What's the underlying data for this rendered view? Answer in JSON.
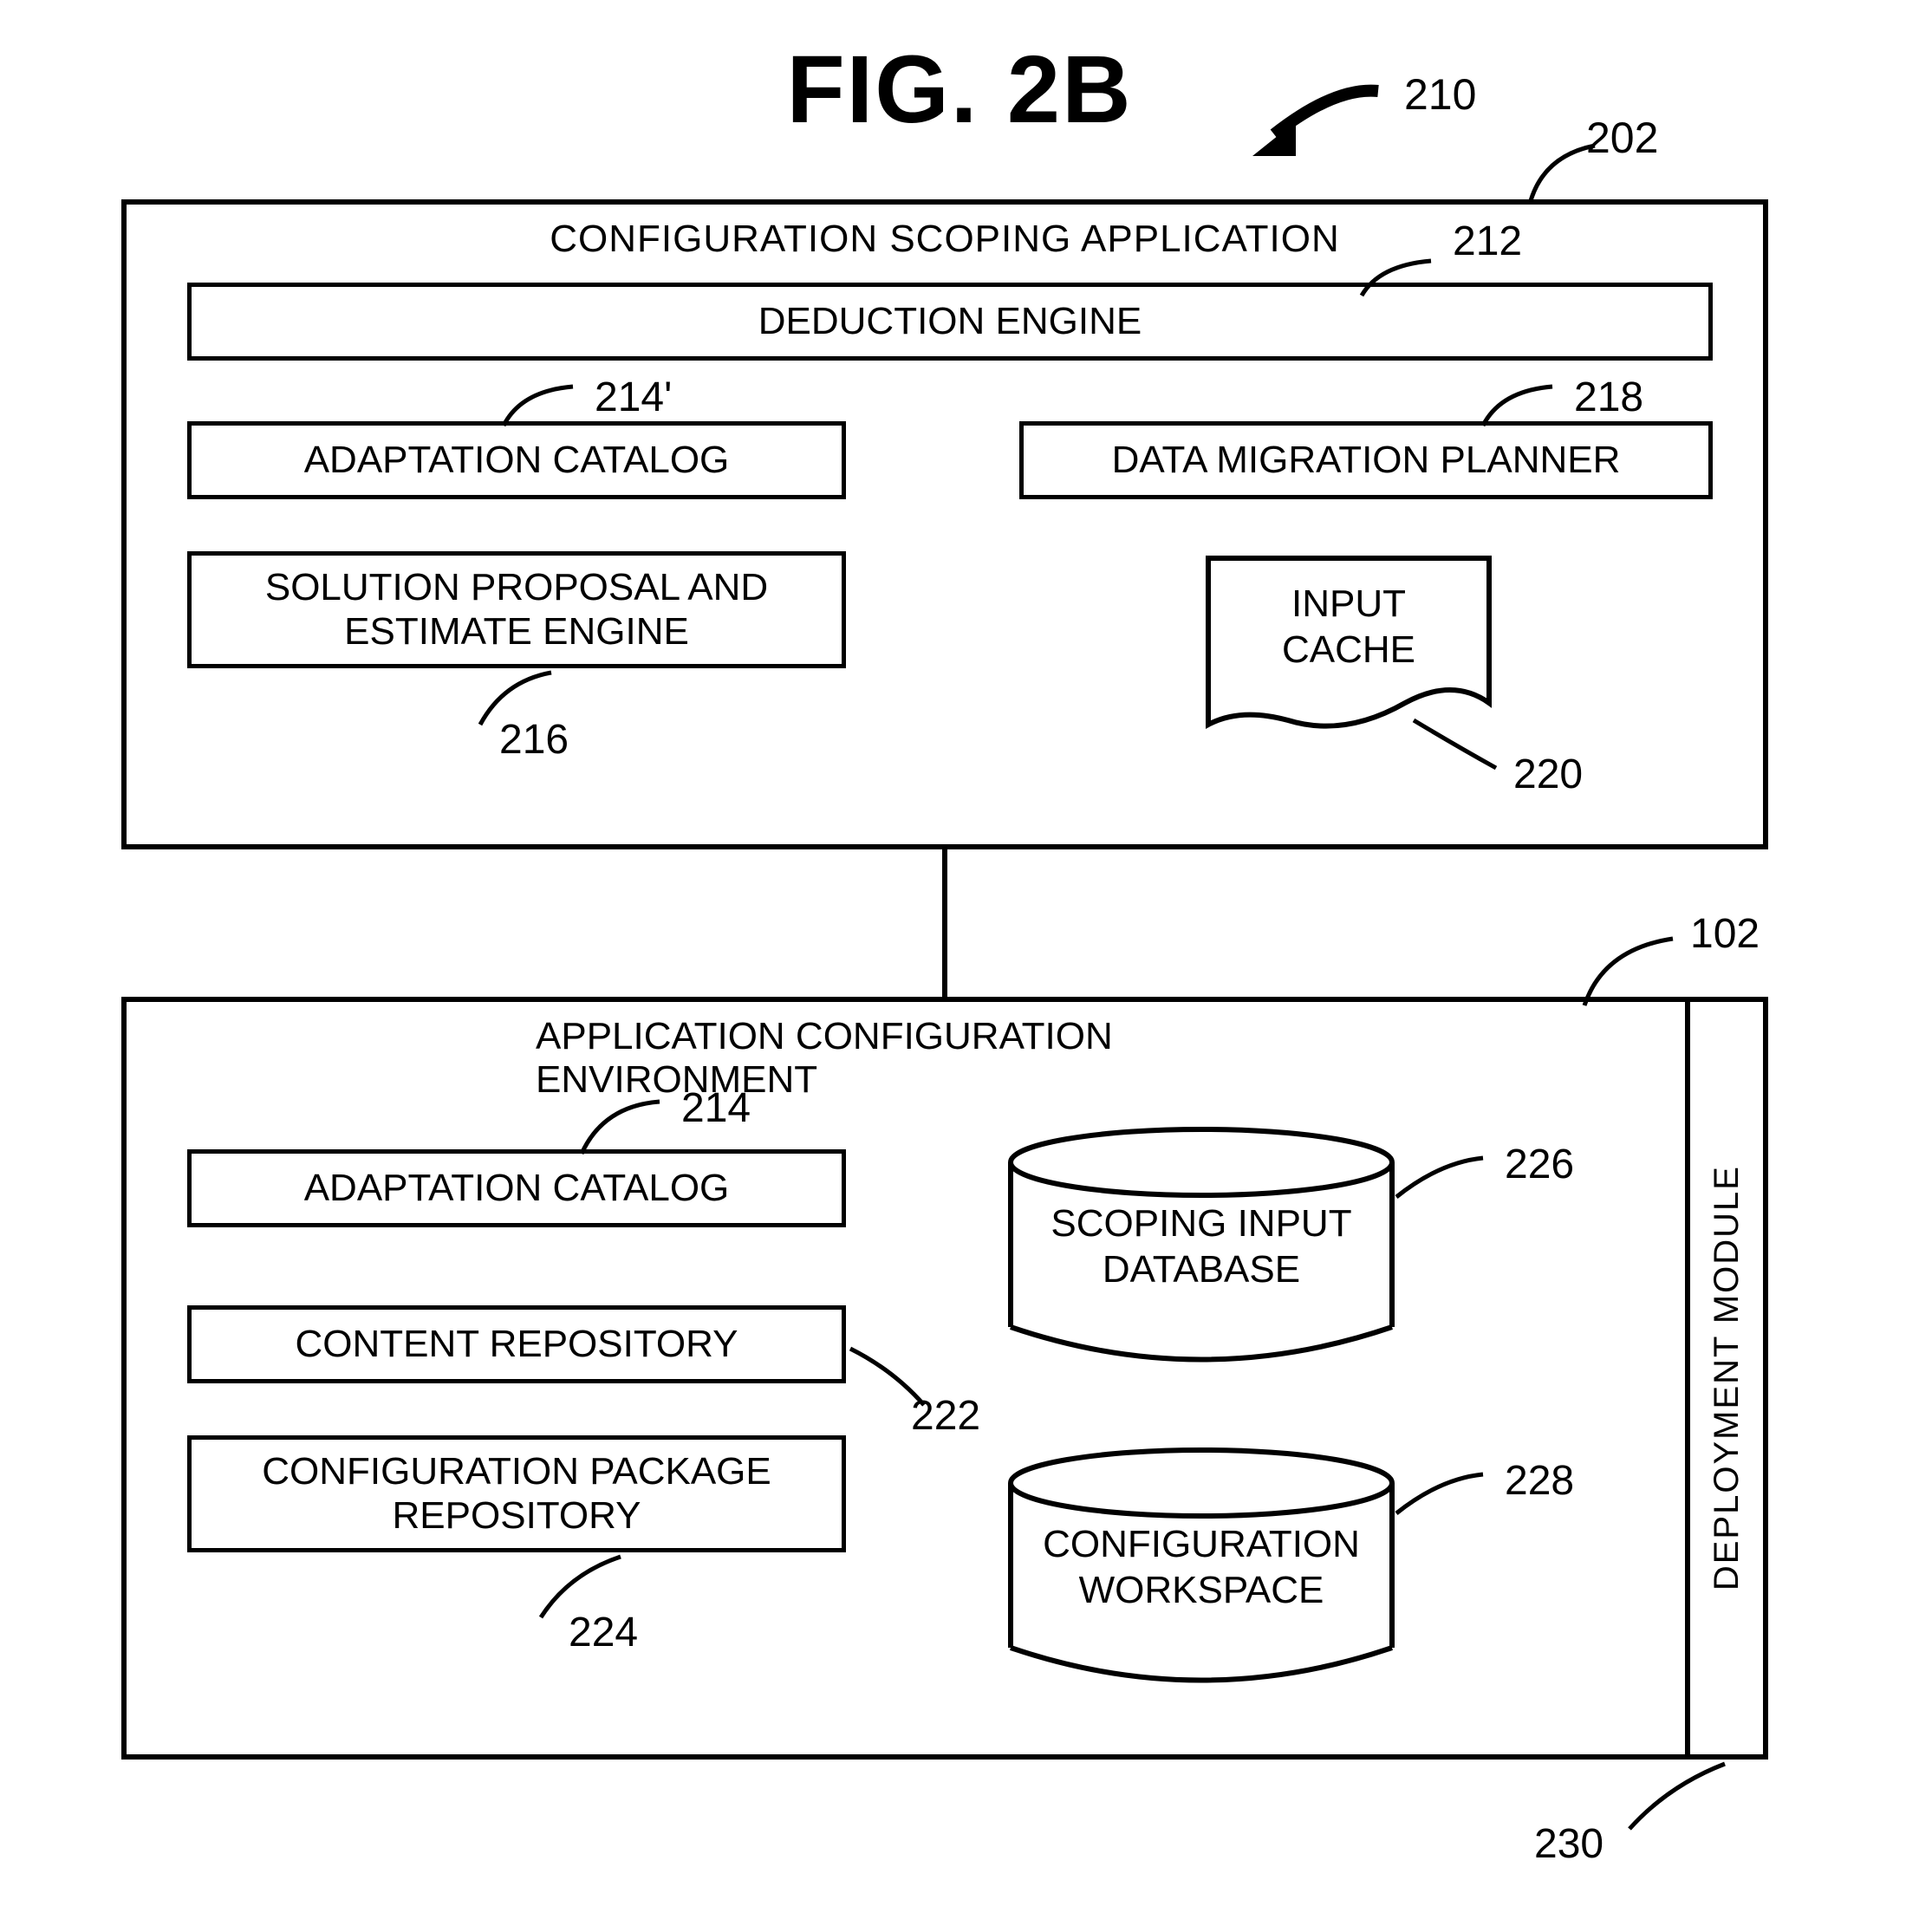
{
  "title": "FIG. 2B",
  "refs": {
    "r210": "210",
    "r202": "202",
    "r212": "212",
    "r214p": "214'",
    "r218": "218",
    "r216": "216",
    "r220": "220",
    "r102": "102",
    "r214": "214",
    "r226": "226",
    "r222": "222",
    "r228": "228",
    "r224": "224",
    "r230": "230"
  },
  "top": {
    "title": "CONFIGURATION SCOPING APPLICATION",
    "deduction": "DEDUCTION ENGINE",
    "adaptation": "ADAPTATION CATALOG",
    "migration": "DATA MIGRATION PLANNER",
    "solution_l1": "SOLUTION PROPOSAL AND",
    "solution_l2": "ESTIMATE ENGINE",
    "cache_l1": "INPUT",
    "cache_l2": "CACHE"
  },
  "bottom": {
    "title": "APPLICATION CONFIGURATION ENVIRONMENT",
    "adaptation": "ADAPTATION CATALOG",
    "content": "CONTENT REPOSITORY",
    "pkg_l1": "CONFIGURATION PACKAGE",
    "pkg_l2": "REPOSITORY",
    "db1_l1": "SCOPING INPUT",
    "db1_l2": "DATABASE",
    "db2_l1": "CONFIGURATION",
    "db2_l2": "WORKSPACE",
    "deploy": "DEPLOYMENT MODULE"
  }
}
